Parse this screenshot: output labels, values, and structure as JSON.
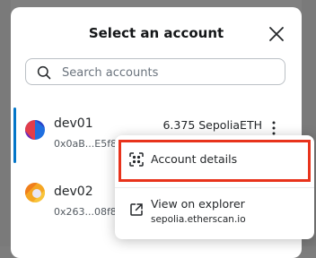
{
  "modal": {
    "title": "Select an account",
    "close_icon": "close-icon"
  },
  "search": {
    "placeholder": "Search accounts",
    "value": "",
    "icon": "search-icon"
  },
  "accounts": [
    {
      "name": "dev01",
      "address": "0x0aB...E5f8",
      "balance": "6.375 SepoliaETH",
      "selected": true
    },
    {
      "name": "dev02",
      "address": "0x263...08f8",
      "balance": "",
      "selected": false
    }
  ],
  "account_menu": {
    "items": [
      {
        "label": "Account details",
        "icon": "scan-icon",
        "highlighted": true
      },
      {
        "label": "View on explorer",
        "sublabel": "sepolia.etherscan.io",
        "icon": "external-link-icon"
      }
    ]
  },
  "colors": {
    "accent": "#0376c9",
    "highlight": "#e8331c",
    "overlay": "#808080"
  }
}
